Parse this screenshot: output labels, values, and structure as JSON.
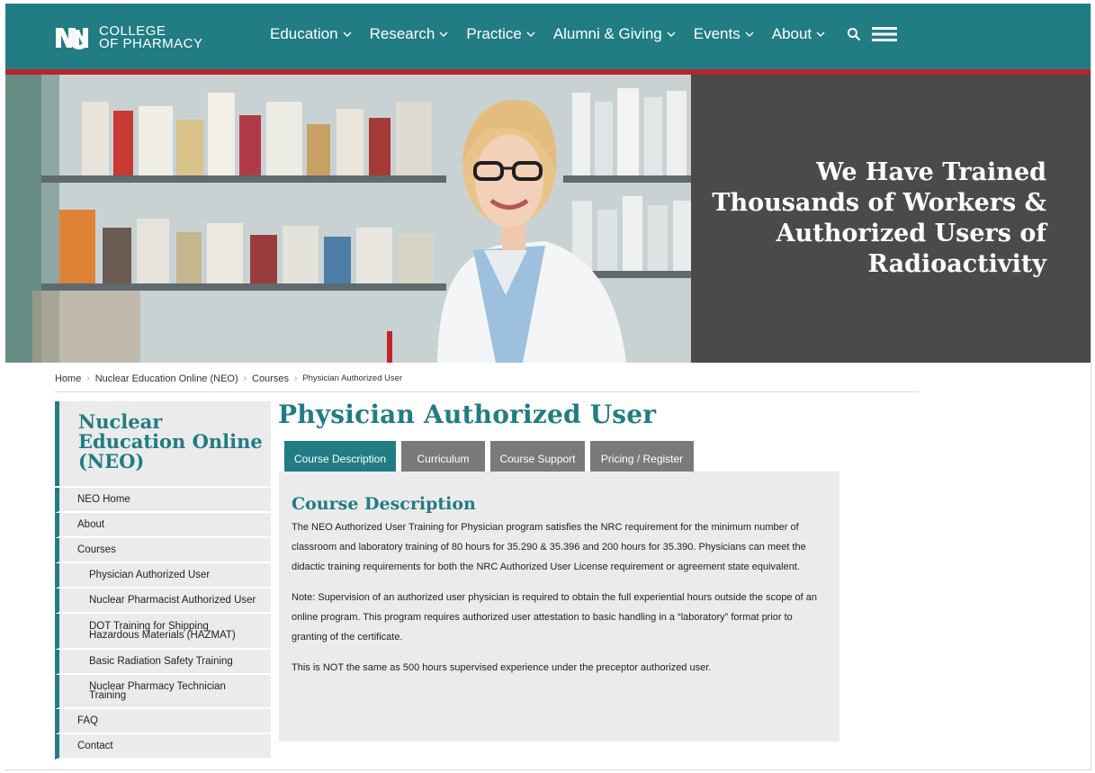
{
  "header": {
    "logo_line1": "COLLEGE",
    "logo_line2": "OF PHARMACY",
    "nav": [
      "Education",
      "Research",
      "Practice",
      "Alumni & Giving",
      "Events",
      "About"
    ],
    "accent_color": "#217c84",
    "stripe_color": "#b8242e"
  },
  "hero": {
    "heading": "We Have Trained Thousands of Workers & Authorized Users of Radioactivity",
    "panel_color": "#4a4a4a"
  },
  "breadcrumb": {
    "items": [
      "Home",
      "Nuclear Education Online (NEO)",
      "Courses"
    ],
    "current": "Physician Authorized User"
  },
  "sidebar": {
    "title": "Nuclear Education Online (NEO)",
    "items": [
      {
        "label": "NEO Home",
        "level": 1
      },
      {
        "label": "About",
        "level": 1
      },
      {
        "label": "Courses",
        "level": 1
      },
      {
        "label": "Physician Authorized User",
        "level": 2
      },
      {
        "label": "Nuclear Pharmacist Authorized User",
        "level": 2
      },
      {
        "label": "DOT Training for Shipping Hazardous Materials (HAZMAT)",
        "level": 2
      },
      {
        "label": "Basic Radiation Safety Training",
        "level": 2
      },
      {
        "label": "Nuclear Pharmacy Technician Training",
        "level": 2
      },
      {
        "label": "FAQ",
        "level": 1
      },
      {
        "label": "Contact",
        "level": 1
      }
    ]
  },
  "main": {
    "title": "Physician Authorized User",
    "tabs": [
      "Course Description",
      "Curriculum",
      "Course Support",
      "Pricing / Register"
    ],
    "active_tab": "Course Description",
    "panel_heading": "Course Description",
    "paragraphs": [
      "The NEO Authorized User Training for Physician program satisfies the NRC requirement for the minimum number of classroom and laboratory training of 80 hours for 35.290 & 35.396 and 200 hours for 35.390. Physicians can meet the didactic training requirements for both the NRC Authorized User License requirement or agreement state equivalent.",
      "Note: Supervision of an authorized user physician is required to obtain the full experiential hours outside the scope of an online program. This program requires authorized user attestation to basic handling in a “laboratory” format prior to granting of the certificate.",
      "This is NOT the same as 500 hours supervised experience under the preceptor authorized user."
    ]
  }
}
